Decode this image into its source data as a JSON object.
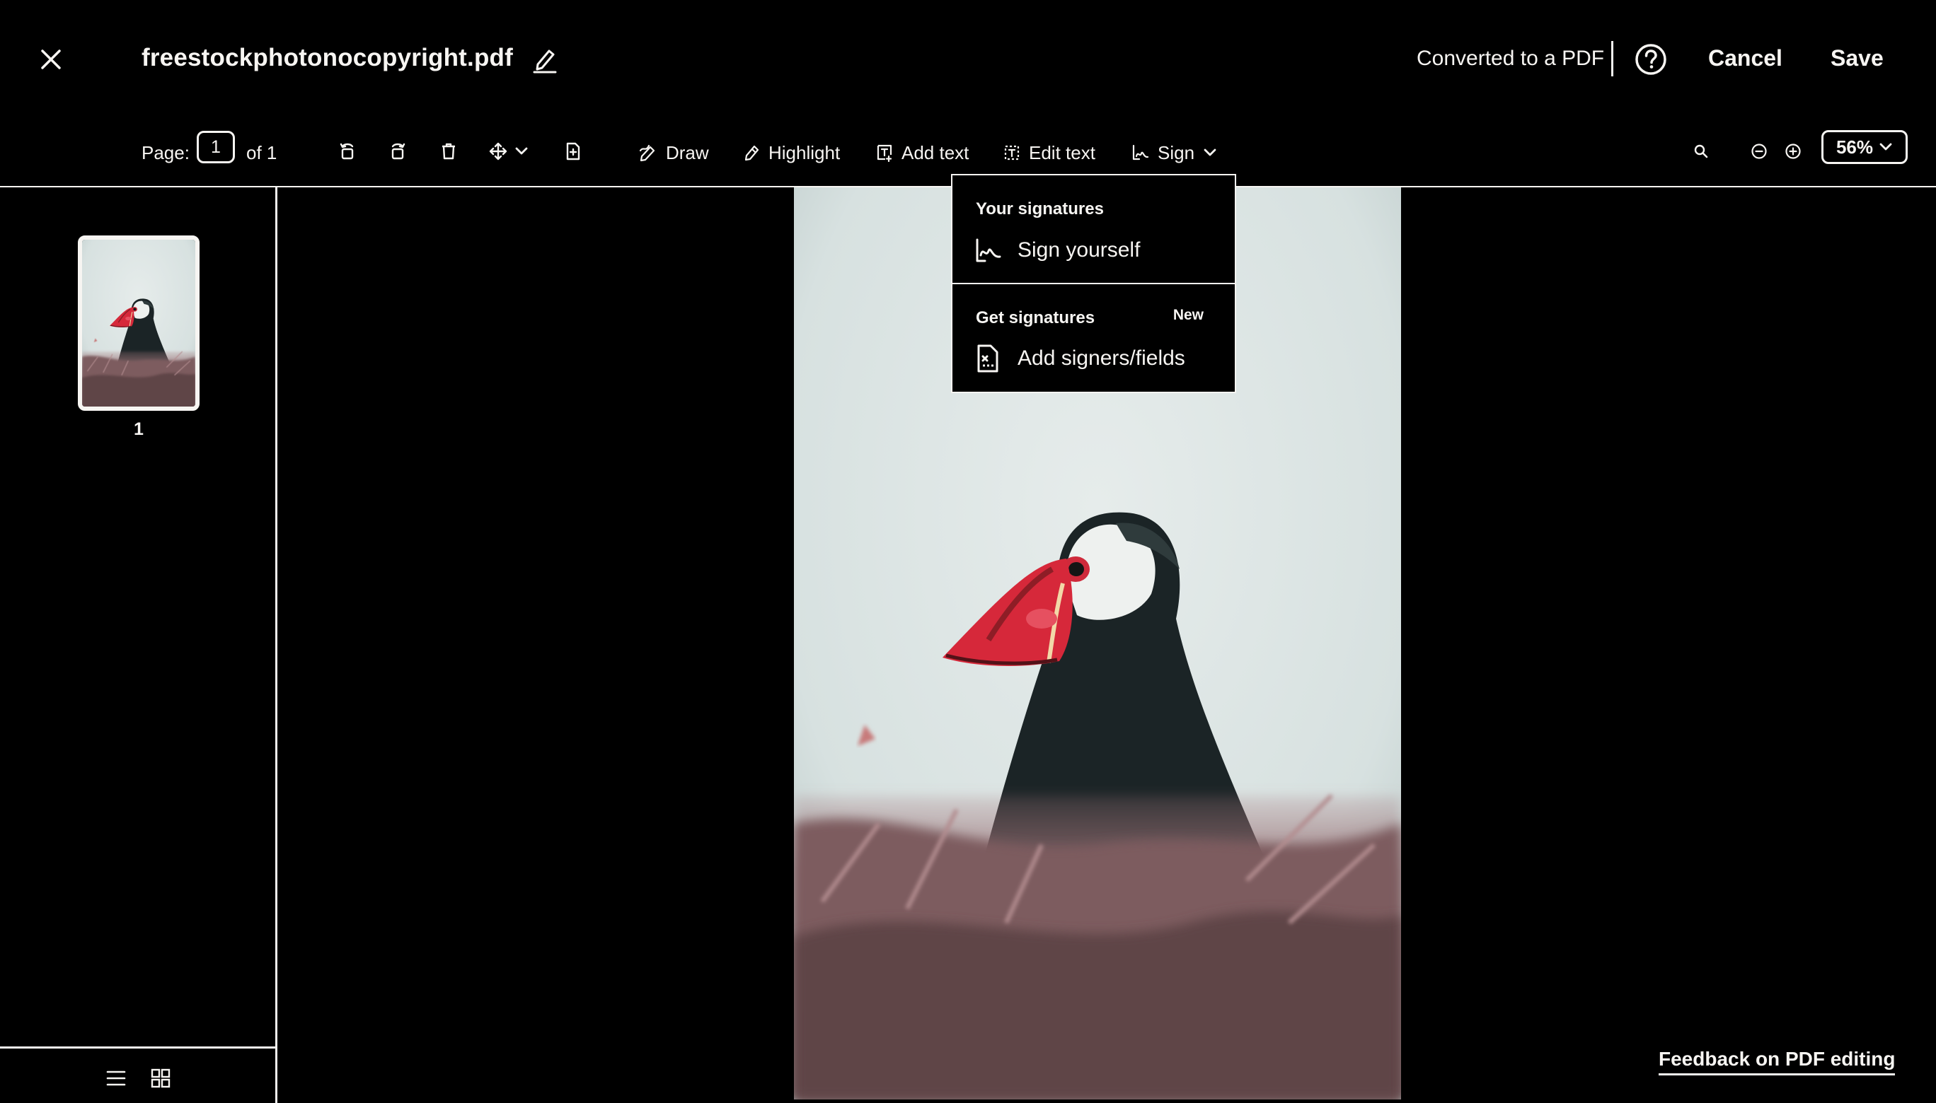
{
  "header": {
    "file_name": "freestockphotonocopyright.pdf",
    "status": "Converted to a PDF",
    "cancel_label": "Cancel",
    "save_label": "Save"
  },
  "toolbar": {
    "page_label": "Page:",
    "page_value": "1",
    "page_total": "of 1",
    "draw_label": "Draw",
    "highlight_label": "Highlight",
    "add_text_label": "Add text",
    "edit_text_label": "Edit text",
    "sign_label": "Sign",
    "zoom_value": "56%"
  },
  "icons": [
    "close-icon",
    "pencil-icon",
    "help-icon",
    "rotate-left-icon",
    "rotate-right-icon",
    "trash-icon",
    "move-icon",
    "chevron-down-icon",
    "insert-page-icon",
    "draw-icon",
    "highlight-icon",
    "add-text-icon",
    "edit-text-icon",
    "sign-icon",
    "search-icon",
    "zoom-out-icon",
    "zoom-in-icon",
    "list-view-icon",
    "grid-view-icon",
    "signature-icon",
    "document-signers-icon"
  ],
  "sidebar": {
    "thumbnails": [
      {
        "page_number": "1"
      }
    ]
  },
  "sign_menu": {
    "your_signatures_title": "Your signatures",
    "sign_yourself_label": "Sign yourself",
    "get_signatures_title": "Get signatures",
    "new_badge": "New",
    "add_signers_label": "Add signers/fields"
  },
  "feedback_label": "Feedback on PDF editing",
  "colors": {
    "background": "#000000",
    "foreground": "#f7f5f2",
    "photo_sky": "#dfe7e6",
    "puffin_beak": "#d6283a"
  }
}
